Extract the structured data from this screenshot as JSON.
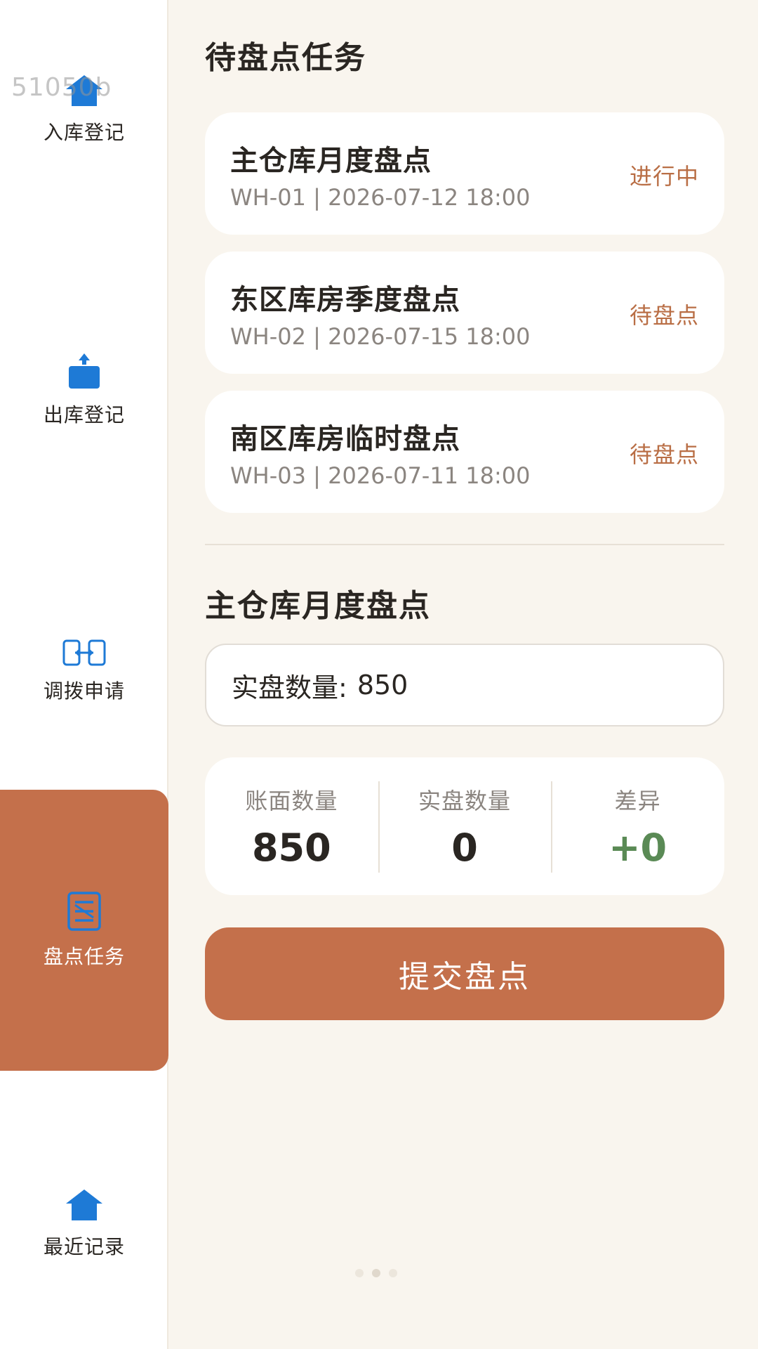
{
  "watermark": "51050b",
  "sidebar": {
    "items": [
      {
        "label": "入库登记",
        "icon": "house-icon"
      },
      {
        "label": "出库登记",
        "icon": "box-upload-icon"
      },
      {
        "label": "调拨申请",
        "icon": "transfer-icon"
      },
      {
        "label": "盘点任务",
        "icon": "clipboard-icon",
        "active": true
      },
      {
        "label": "最近记录",
        "icon": "house-icon"
      }
    ]
  },
  "pending": {
    "title": "待盘点任务",
    "tasks": [
      {
        "name": "主仓库月度盘点",
        "meta": "WH-01 | 2026-07-12 18:00",
        "status": "进行中"
      },
      {
        "name": "东区库房季度盘点",
        "meta": "WH-02 | 2026-07-15 18:00",
        "status": "待盘点"
      },
      {
        "name": "南区库房临时盘点",
        "meta": "WH-03 | 2026-07-11 18:00",
        "status": "待盘点"
      }
    ]
  },
  "detail": {
    "title": "主仓库月度盘点",
    "count_label": "实盘数量:",
    "count_value": "850",
    "stats": [
      {
        "label": "账面数量",
        "value": "850"
      },
      {
        "label": "实盘数量",
        "value": "0"
      },
      {
        "label": "差异",
        "value": "+0"
      }
    ],
    "submit_label": "提交盘点"
  },
  "colors": {
    "accent": "#c4704b",
    "status_text": "#b96e45",
    "diff_positive": "#5a8a55",
    "icon_blue": "#1e7ad6",
    "background": "#f9f5ee"
  }
}
